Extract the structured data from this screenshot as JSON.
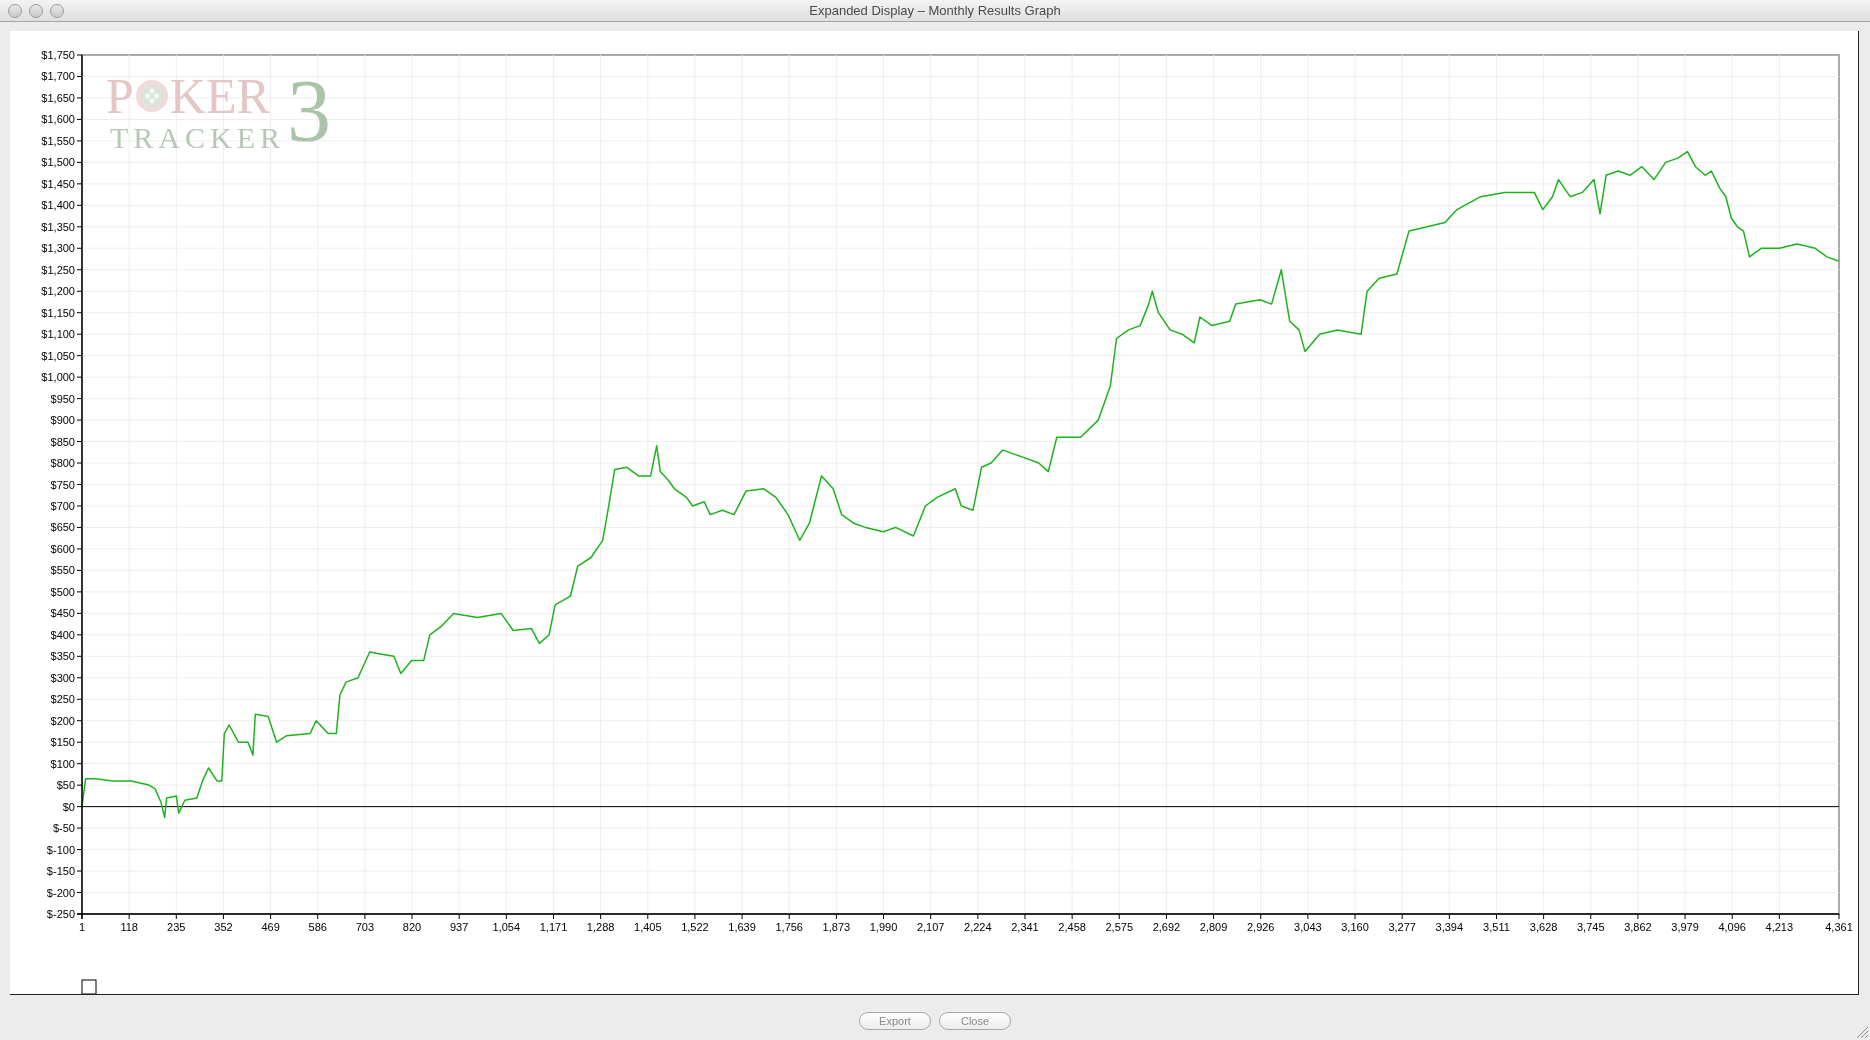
{
  "window": {
    "title": "Expanded Display – Monthly Results Graph",
    "active": false
  },
  "chart": {
    "logo": {
      "poker_start": "P",
      "poker_end": "KER",
      "tracker": "TRACKER",
      "number": "3"
    },
    "chart_data": {
      "type": "line",
      "grid": true,
      "xlim": [
        1,
        4361
      ],
      "ylim": [
        -250,
        1750
      ],
      "x": [
        1,
        10,
        34,
        78,
        123,
        167,
        182,
        197,
        206,
        211,
        235,
        241,
        256,
        286,
        300,
        315,
        336,
        348,
        354,
        366,
        389,
        413,
        425,
        431,
        463,
        484,
        508,
        567,
        582,
        612,
        632,
        641,
        656,
        686,
        715,
        745,
        775,
        792,
        819,
        849,
        864,
        893,
        923,
        982,
        1041,
        1071,
        1116,
        1136,
        1160,
        1175,
        1213,
        1231,
        1264,
        1293,
        1308,
        1323,
        1353,
        1382,
        1412,
        1427,
        1436,
        1456,
        1471,
        1501,
        1516,
        1545,
        1560,
        1590,
        1619,
        1649,
        1693,
        1723,
        1753,
        1782,
        1806,
        1836,
        1865,
        1886,
        1916,
        1945,
        1990,
        2020,
        2064,
        2094,
        2123,
        2168,
        2183,
        2212,
        2233,
        2257,
        2286,
        2316,
        2375,
        2399,
        2420,
        2479,
        2523,
        2553,
        2568,
        2598,
        2627,
        2648,
        2657,
        2672,
        2701,
        2731,
        2761,
        2775,
        2805,
        2849,
        2864,
        2924,
        2953,
        2977,
        2998,
        3021,
        3036,
        3072,
        3116,
        3175,
        3190,
        3220,
        3264,
        3294,
        3339,
        3383,
        3413,
        3472,
        3531,
        3605,
        3626,
        3650,
        3665,
        3694,
        3724,
        3753,
        3768,
        3783,
        3813,
        3842,
        3872,
        3902,
        3931,
        3961,
        3985,
        4005,
        4029,
        4044,
        4065,
        4080,
        4094,
        4109,
        4124,
        4139,
        4168,
        4213,
        4257,
        4302,
        4331,
        4361
      ],
      "series": [
        {
          "color": "#1db31d",
          "values": [
            0,
            65,
            65,
            60,
            60,
            50,
            42,
            10,
            -25,
            20,
            25,
            -15,
            15,
            20,
            60,
            90,
            60,
            60,
            170,
            190,
            150,
            150,
            120,
            215,
            210,
            150,
            165,
            170,
            200,
            170,
            170,
            260,
            290,
            300,
            360,
            355,
            350,
            310,
            340,
            340,
            400,
            420,
            450,
            440,
            450,
            410,
            415,
            380,
            400,
            470,
            490,
            560,
            580,
            620,
            700,
            785,
            790,
            770,
            770,
            840,
            780,
            760,
            740,
            720,
            700,
            710,
            680,
            690,
            680,
            735,
            740,
            720,
            680,
            620,
            660,
            770,
            740,
            680,
            660,
            650,
            640,
            650,
            630,
            700,
            720,
            740,
            700,
            690,
            790,
            800,
            830,
            820,
            800,
            780,
            860,
            860,
            900,
            980,
            1090,
            1110,
            1120,
            1170,
            1200,
            1150,
            1110,
            1100,
            1080,
            1140,
            1120,
            1130,
            1170,
            1180,
            1170,
            1250,
            1130,
            1110,
            1060,
            1100,
            1110,
            1100,
            1200,
            1230,
            1240,
            1340,
            1350,
            1360,
            1390,
            1420,
            1430,
            1430,
            1390,
            1420,
            1460,
            1420,
            1430,
            1460,
            1380,
            1470,
            1480,
            1470,
            1490,
            1460,
            1500,
            1510,
            1525,
            1490,
            1470,
            1480,
            1440,
            1420,
            1370,
            1350,
            1340,
            1280,
            1300,
            1300,
            1310,
            1300,
            1280,
            1270
          ]
        }
      ],
      "xticks": [
        {
          "value": 1,
          "label": "1"
        },
        {
          "value": 118,
          "label": "118"
        },
        {
          "value": 235,
          "label": "235"
        },
        {
          "value": 352,
          "label": "352"
        },
        {
          "value": 469,
          "label": "469"
        },
        {
          "value": 586,
          "label": "586"
        },
        {
          "value": 703,
          "label": "703"
        },
        {
          "value": 820,
          "label": "820"
        },
        {
          "value": 937,
          "label": "937"
        },
        {
          "value": 1054,
          "label": "1,054"
        },
        {
          "value": 1171,
          "label": "1,171"
        },
        {
          "value": 1288,
          "label": "1,288"
        },
        {
          "value": 1405,
          "label": "1,405"
        },
        {
          "value": 1522,
          "label": "1,522"
        },
        {
          "value": 1639,
          "label": "1,639"
        },
        {
          "value": 1756,
          "label": "1,756"
        },
        {
          "value": 1873,
          "label": "1,873"
        },
        {
          "value": 1990,
          "label": "1,990"
        },
        {
          "value": 2107,
          "label": "2,107"
        },
        {
          "value": 2224,
          "label": "2,224"
        },
        {
          "value": 2341,
          "label": "2,341"
        },
        {
          "value": 2458,
          "label": "2,458"
        },
        {
          "value": 2575,
          "label": "2,575"
        },
        {
          "value": 2692,
          "label": "2,692"
        },
        {
          "value": 2809,
          "label": "2,809"
        },
        {
          "value": 2926,
          "label": "2,926"
        },
        {
          "value": 3043,
          "label": "3,043"
        },
        {
          "value": 3160,
          "label": "3,160"
        },
        {
          "value": 3277,
          "label": "3,277"
        },
        {
          "value": 3394,
          "label": "3,394"
        },
        {
          "value": 3511,
          "label": "3,511"
        },
        {
          "value": 3628,
          "label": "3,628"
        },
        {
          "value": 3745,
          "label": "3,745"
        },
        {
          "value": 3862,
          "label": "3,862"
        },
        {
          "value": 3979,
          "label": "3,979"
        },
        {
          "value": 4096,
          "label": "4,096"
        },
        {
          "value": 4213,
          "label": "4,213"
        },
        {
          "value": 4361,
          "label": "4,361"
        }
      ],
      "yticks": [
        {
          "value": 1750,
          "label": "$1,750"
        },
        {
          "value": 1700,
          "label": "$1,700"
        },
        {
          "value": 1650,
          "label": "$1,650"
        },
        {
          "value": 1600,
          "label": "$1,600"
        },
        {
          "value": 1550,
          "label": "$1,550"
        },
        {
          "value": 1500,
          "label": "$1,500"
        },
        {
          "value": 1450,
          "label": "$1,450"
        },
        {
          "value": 1400,
          "label": "$1,400"
        },
        {
          "value": 1350,
          "label": "$1,350"
        },
        {
          "value": 1300,
          "label": "$1,300"
        },
        {
          "value": 1250,
          "label": "$1,250"
        },
        {
          "value": 1200,
          "label": "$1,200"
        },
        {
          "value": 1150,
          "label": "$1,150"
        },
        {
          "value": 1100,
          "label": "$1,100"
        },
        {
          "value": 1050,
          "label": "$1,050"
        },
        {
          "value": 1000,
          "label": "$1,000"
        },
        {
          "value": 950,
          "label": "$950"
        },
        {
          "value": 900,
          "label": "$900"
        },
        {
          "value": 850,
          "label": "$850"
        },
        {
          "value": 800,
          "label": "$800"
        },
        {
          "value": 750,
          "label": "$750"
        },
        {
          "value": 700,
          "label": "$700"
        },
        {
          "value": 650,
          "label": "$650"
        },
        {
          "value": 600,
          "label": "$600"
        },
        {
          "value": 550,
          "label": "$550"
        },
        {
          "value": 500,
          "label": "$500"
        },
        {
          "value": 450,
          "label": "$450"
        },
        {
          "value": 400,
          "label": "$400"
        },
        {
          "value": 350,
          "label": "$350"
        },
        {
          "value": 300,
          "label": "$300"
        },
        {
          "value": 250,
          "label": "$250"
        },
        {
          "value": 200,
          "label": "$200"
        },
        {
          "value": 150,
          "label": "$150"
        },
        {
          "value": 100,
          "label": "$100"
        },
        {
          "value": 50,
          "label": "$50"
        },
        {
          "value": 0,
          "label": "$0"
        },
        {
          "value": -50,
          "label": "$-50"
        },
        {
          "value": -100,
          "label": "$-100"
        },
        {
          "value": -150,
          "label": "$-150"
        },
        {
          "value": -200,
          "label": "$-200"
        },
        {
          "value": -250,
          "label": "$-250"
        }
      ]
    }
  },
  "buttons": [
    {
      "label": "Export"
    },
    {
      "label": "Close"
    }
  ]
}
